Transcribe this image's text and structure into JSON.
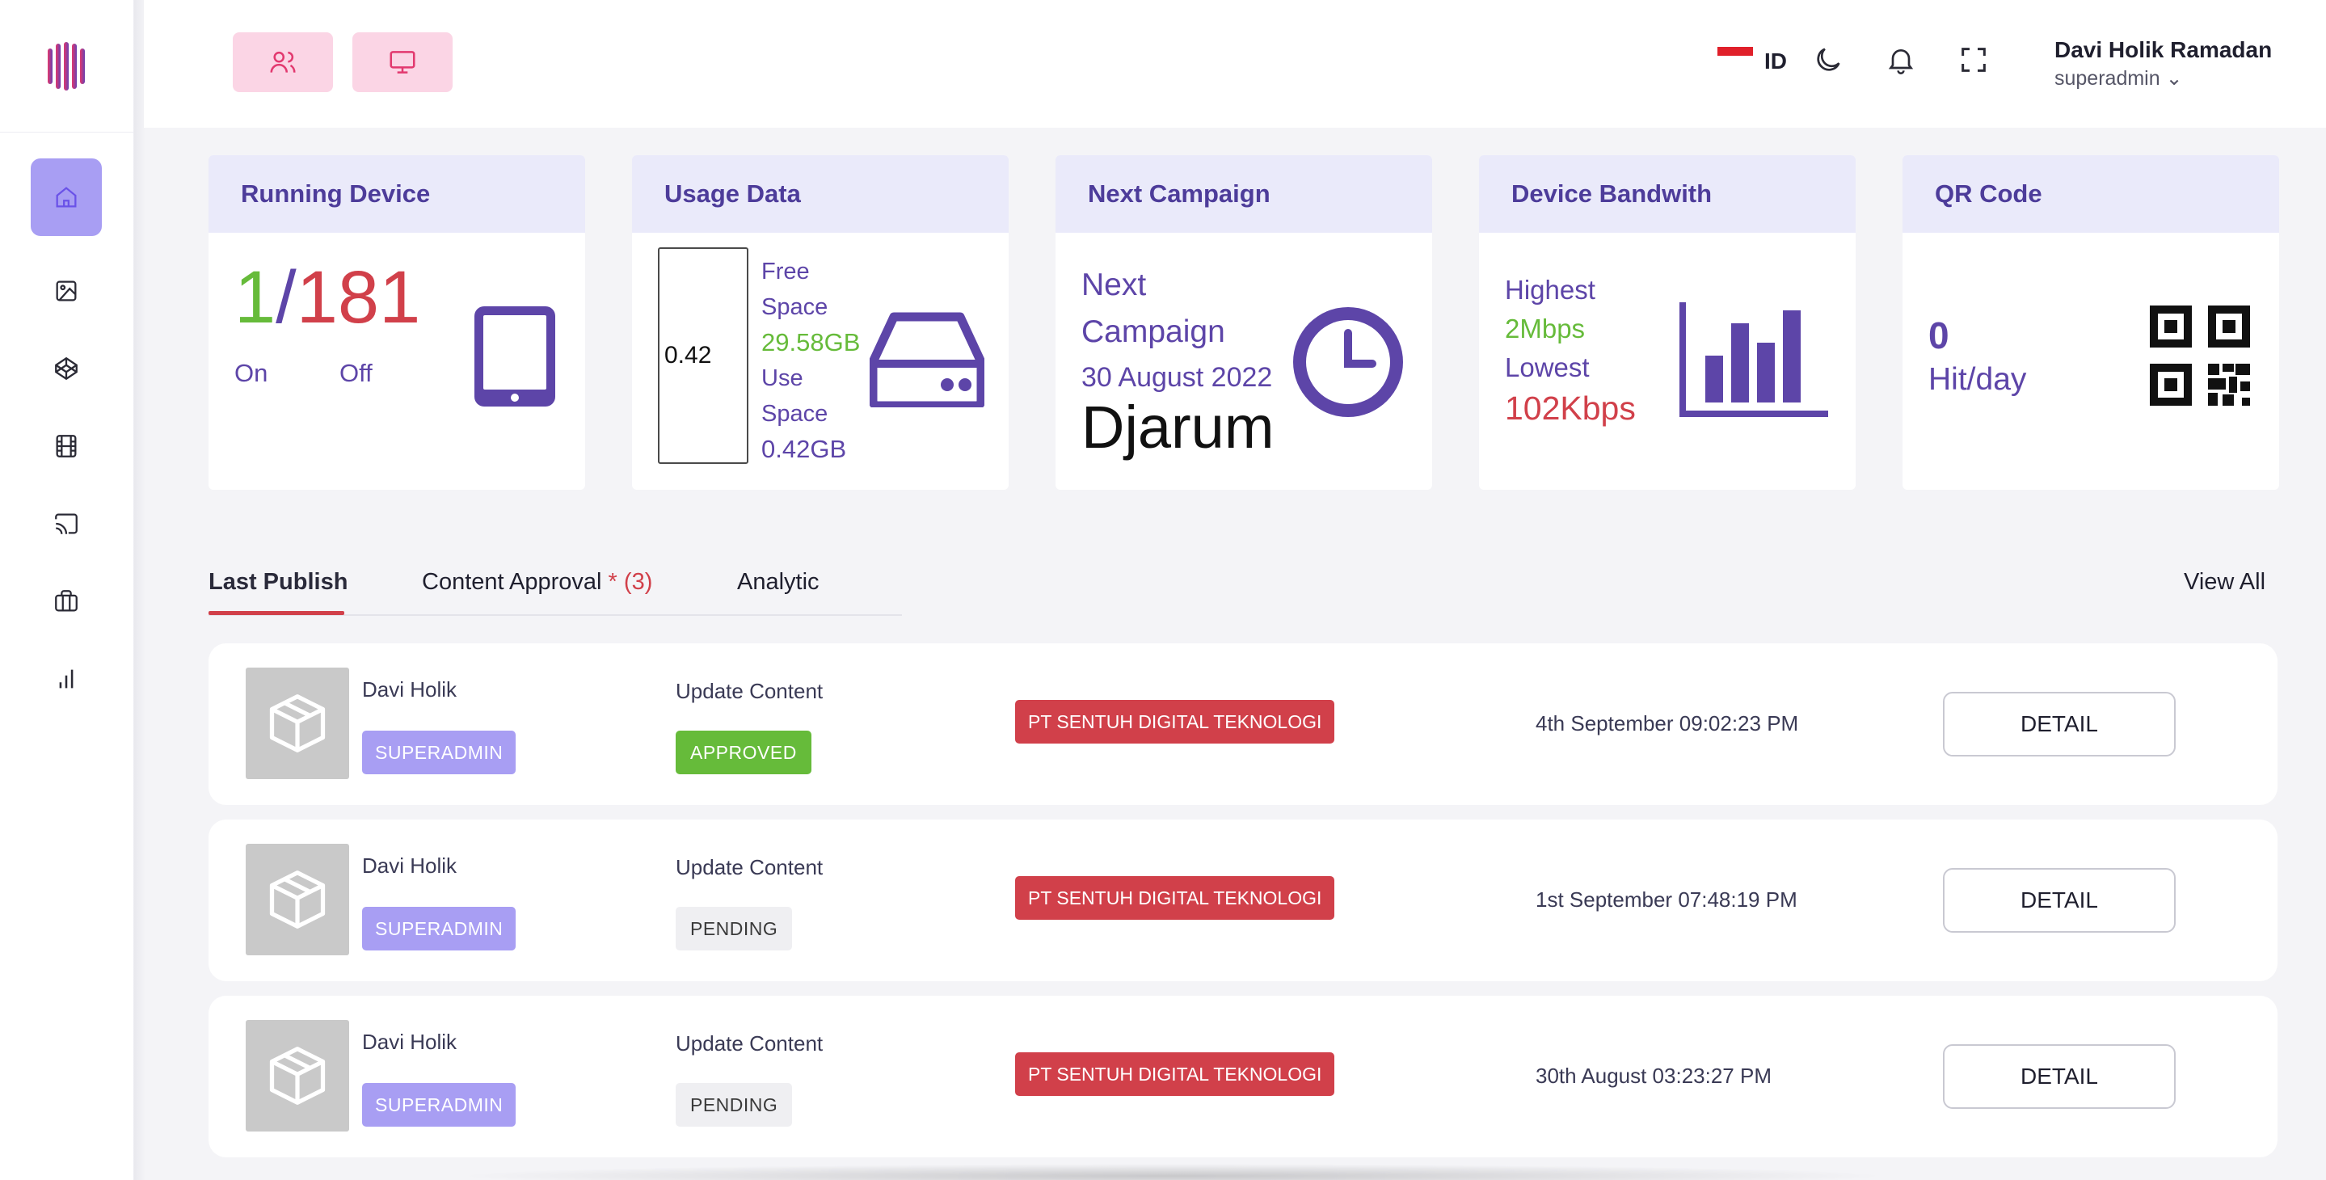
{
  "header": {
    "language": "ID",
    "user_name": "Davi Holik Ramadan",
    "user_role": "superadmin ⌄"
  },
  "cards": {
    "running_device": {
      "title": "Running Device",
      "on_count": "1",
      "separator": "/",
      "total": "181",
      "on_label": "On",
      "off_label": "Off"
    },
    "usage_data": {
      "title": "Usage Data",
      "gauge_value": "0.42",
      "free_label_1": "Free",
      "free_label_2": "Space",
      "free_value": "29.58GB",
      "use_label_1": "Use",
      "use_label_2": "Space",
      "use_value": "0.42GB"
    },
    "next_campaign": {
      "title": "Next Campaign",
      "label_1": "Next",
      "label_2": "Campaign",
      "date": "30 August 2022",
      "name": "Djarum"
    },
    "device_bandwidth": {
      "title": "Device Bandwith",
      "highest_label": "Highest",
      "highest_value": "2Mbps",
      "lowest_label": "Lowest",
      "lowest_value": "102Kbps"
    },
    "qr_code": {
      "title": "QR Code",
      "hits": "0",
      "hits_label": "Hit/day"
    }
  },
  "tabs": {
    "items": [
      {
        "label": "Last Publish"
      },
      {
        "label": "Content Approval"
      },
      {
        "label": "Analytic"
      }
    ],
    "approval_star": "*",
    "approval_count": "(3)",
    "view_all": "View All"
  },
  "rows": [
    {
      "name": "Davi Holik",
      "role": "SUPERADMIN",
      "action": "Update Content",
      "status": "APPROVED",
      "company": "PT SENTUH DIGITAL TEKNOLOGI",
      "date": "4th September 09:02:23 PM",
      "detail": "DETAIL"
    },
    {
      "name": "Davi Holik",
      "role": "SUPERADMIN",
      "action": "Update Content",
      "status": "PENDING",
      "company": "PT SENTUH DIGITAL TEKNOLOGI",
      "date": "1st September 07:48:19 PM",
      "detail": "DETAIL"
    },
    {
      "name": "Davi Holik",
      "role": "SUPERADMIN",
      "action": "Update Content",
      "status": "PENDING",
      "company": "PT SENTUH DIGITAL TEKNOLOGI",
      "date": "30th August 03:23:27 PM",
      "detail": "DETAIL"
    }
  ],
  "colors": {
    "accent_purple": "#5d45a8",
    "accent_green": "#66bb3a",
    "accent_red": "#d1404a",
    "sidebar_active": "#a89ef3",
    "header_button": "#fbd5e5"
  }
}
